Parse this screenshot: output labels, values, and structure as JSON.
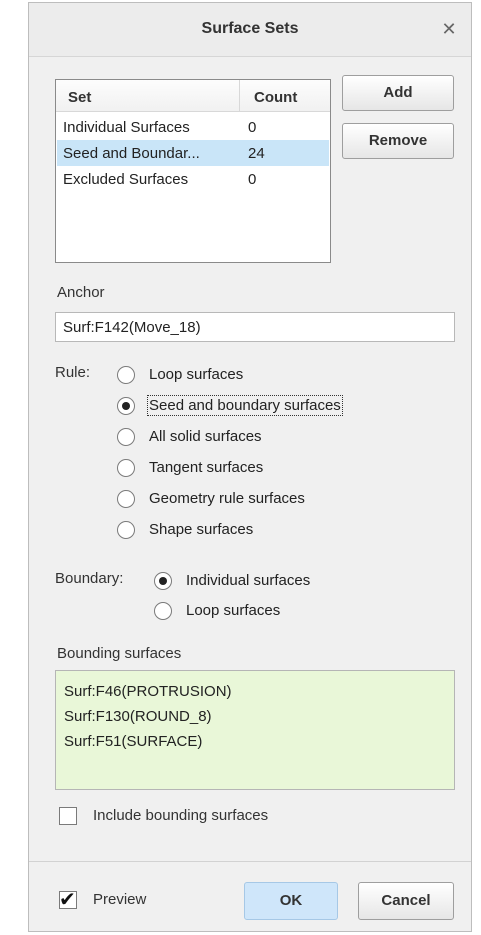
{
  "dialog": {
    "title": "Surface Sets"
  },
  "set_table": {
    "columns": [
      "Set",
      "Count"
    ],
    "rows": [
      {
        "name": "Individual Surfaces",
        "count": "0",
        "selected": false
      },
      {
        "name": "Seed and Boundar...",
        "count": "24",
        "selected": true
      },
      {
        "name": "Excluded Surfaces",
        "count": "0",
        "selected": false
      }
    ]
  },
  "buttons": {
    "add": "Add",
    "remove": "Remove",
    "ok": "OK",
    "cancel": "Cancel"
  },
  "anchor": {
    "label": "Anchor",
    "value": "Surf:F142(Move_18)"
  },
  "rule": {
    "label": "Rule:",
    "options": [
      {
        "label": "Loop surfaces",
        "checked": false
      },
      {
        "label": "Seed and boundary surfaces",
        "checked": true
      },
      {
        "label": "All solid surfaces",
        "checked": false
      },
      {
        "label": "Tangent surfaces",
        "checked": false
      },
      {
        "label": "Geometry rule surfaces",
        "checked": false
      },
      {
        "label": "Shape surfaces",
        "checked": false
      }
    ]
  },
  "boundary": {
    "label": "Boundary:",
    "options": [
      {
        "label": "Individual surfaces",
        "checked": true
      },
      {
        "label": "Loop surfaces",
        "checked": false
      }
    ]
  },
  "bounding_surfaces": {
    "label": "Bounding surfaces",
    "items": [
      "Surf:F46(PROTRUSION)",
      "Surf:F130(ROUND_8)",
      "Surf:F51(SURFACE)"
    ]
  },
  "include_bounding": {
    "label": "Include bounding surfaces",
    "checked": false
  },
  "preview": {
    "label": "Preview",
    "checked": true
  },
  "icons": {
    "close": "close-icon"
  }
}
